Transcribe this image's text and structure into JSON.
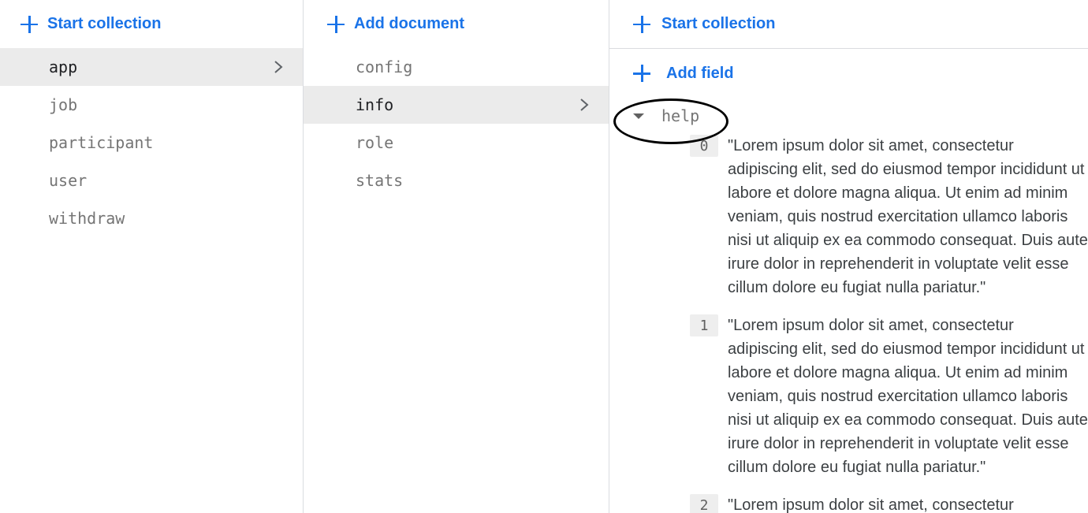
{
  "left": {
    "action_label": "Start collection",
    "items": [
      {
        "label": "app",
        "selected": true
      },
      {
        "label": "job"
      },
      {
        "label": "participant"
      },
      {
        "label": "user"
      },
      {
        "label": "withdraw"
      }
    ]
  },
  "mid": {
    "action_label": "Add document",
    "items": [
      {
        "label": "config"
      },
      {
        "label": "info",
        "selected": true
      },
      {
        "label": "role"
      },
      {
        "label": "stats"
      }
    ]
  },
  "right": {
    "action_label": "Start collection",
    "addfield_label": "Add field",
    "field": {
      "name": "help",
      "entries": [
        {
          "index": "0",
          "value": "\"Lorem ipsum dolor sit amet, consectetur adipiscing elit, sed do eiusmod tempor incididunt ut labore et dolore magna aliqua. Ut enim ad minim veniam, quis nostrud exercitation ullamco laboris nisi ut aliquip ex ea commodo consequat. Duis aute irure dolor in reprehenderit in voluptate velit esse cillum dolore eu fugiat nulla pariatur.\""
        },
        {
          "index": "1",
          "value": "\"Lorem ipsum dolor sit amet, consectetur adipiscing elit, sed do eiusmod tempor incididunt ut labore et dolore magna aliqua. Ut enim ad minim veniam, quis nostrud exercitation ullamco laboris nisi ut aliquip ex ea commodo consequat. Duis aute irure dolor in reprehenderit in voluptate velit esse cillum dolore eu fugiat nulla pariatur.\""
        },
        {
          "index": "2",
          "value": "\"Lorem ipsum dolor sit amet, consectetur"
        }
      ]
    }
  },
  "colors": {
    "accent": "#1a73e8",
    "selected_bg": "#ebebeb",
    "border": "#dadce0"
  }
}
